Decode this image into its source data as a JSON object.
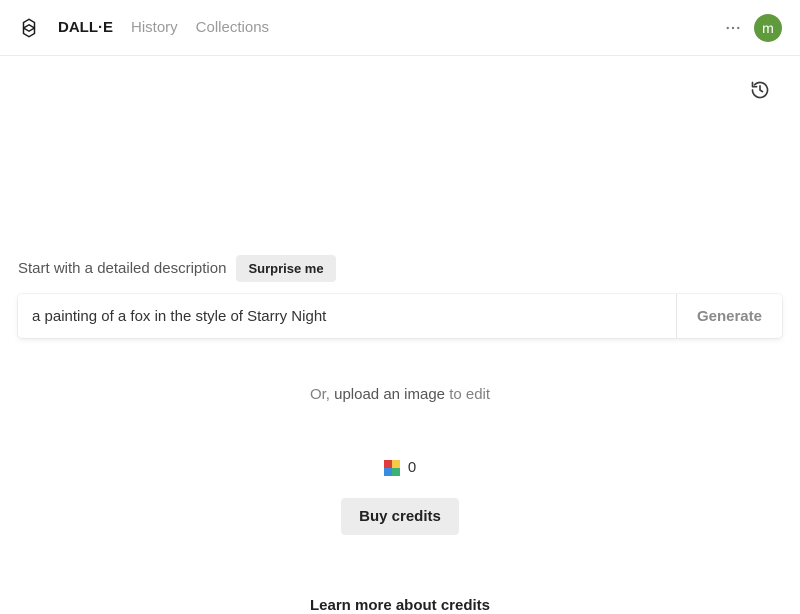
{
  "header": {
    "nav": {
      "dalle": "DALL·E",
      "history": "History",
      "collections": "Collections"
    },
    "avatar_initial": "m"
  },
  "main": {
    "intro_label": "Start with a detailed description",
    "surprise_label": "Surprise me",
    "prompt_value": "a painting of a fox in the style of Starry Night",
    "generate_label": "Generate",
    "upload_prefix": "Or, ",
    "upload_link": "upload an image",
    "upload_suffix": " to edit",
    "credits_count": "0",
    "buy_credits_label": "Buy credits",
    "learn_more_label": "Learn more about credits"
  }
}
